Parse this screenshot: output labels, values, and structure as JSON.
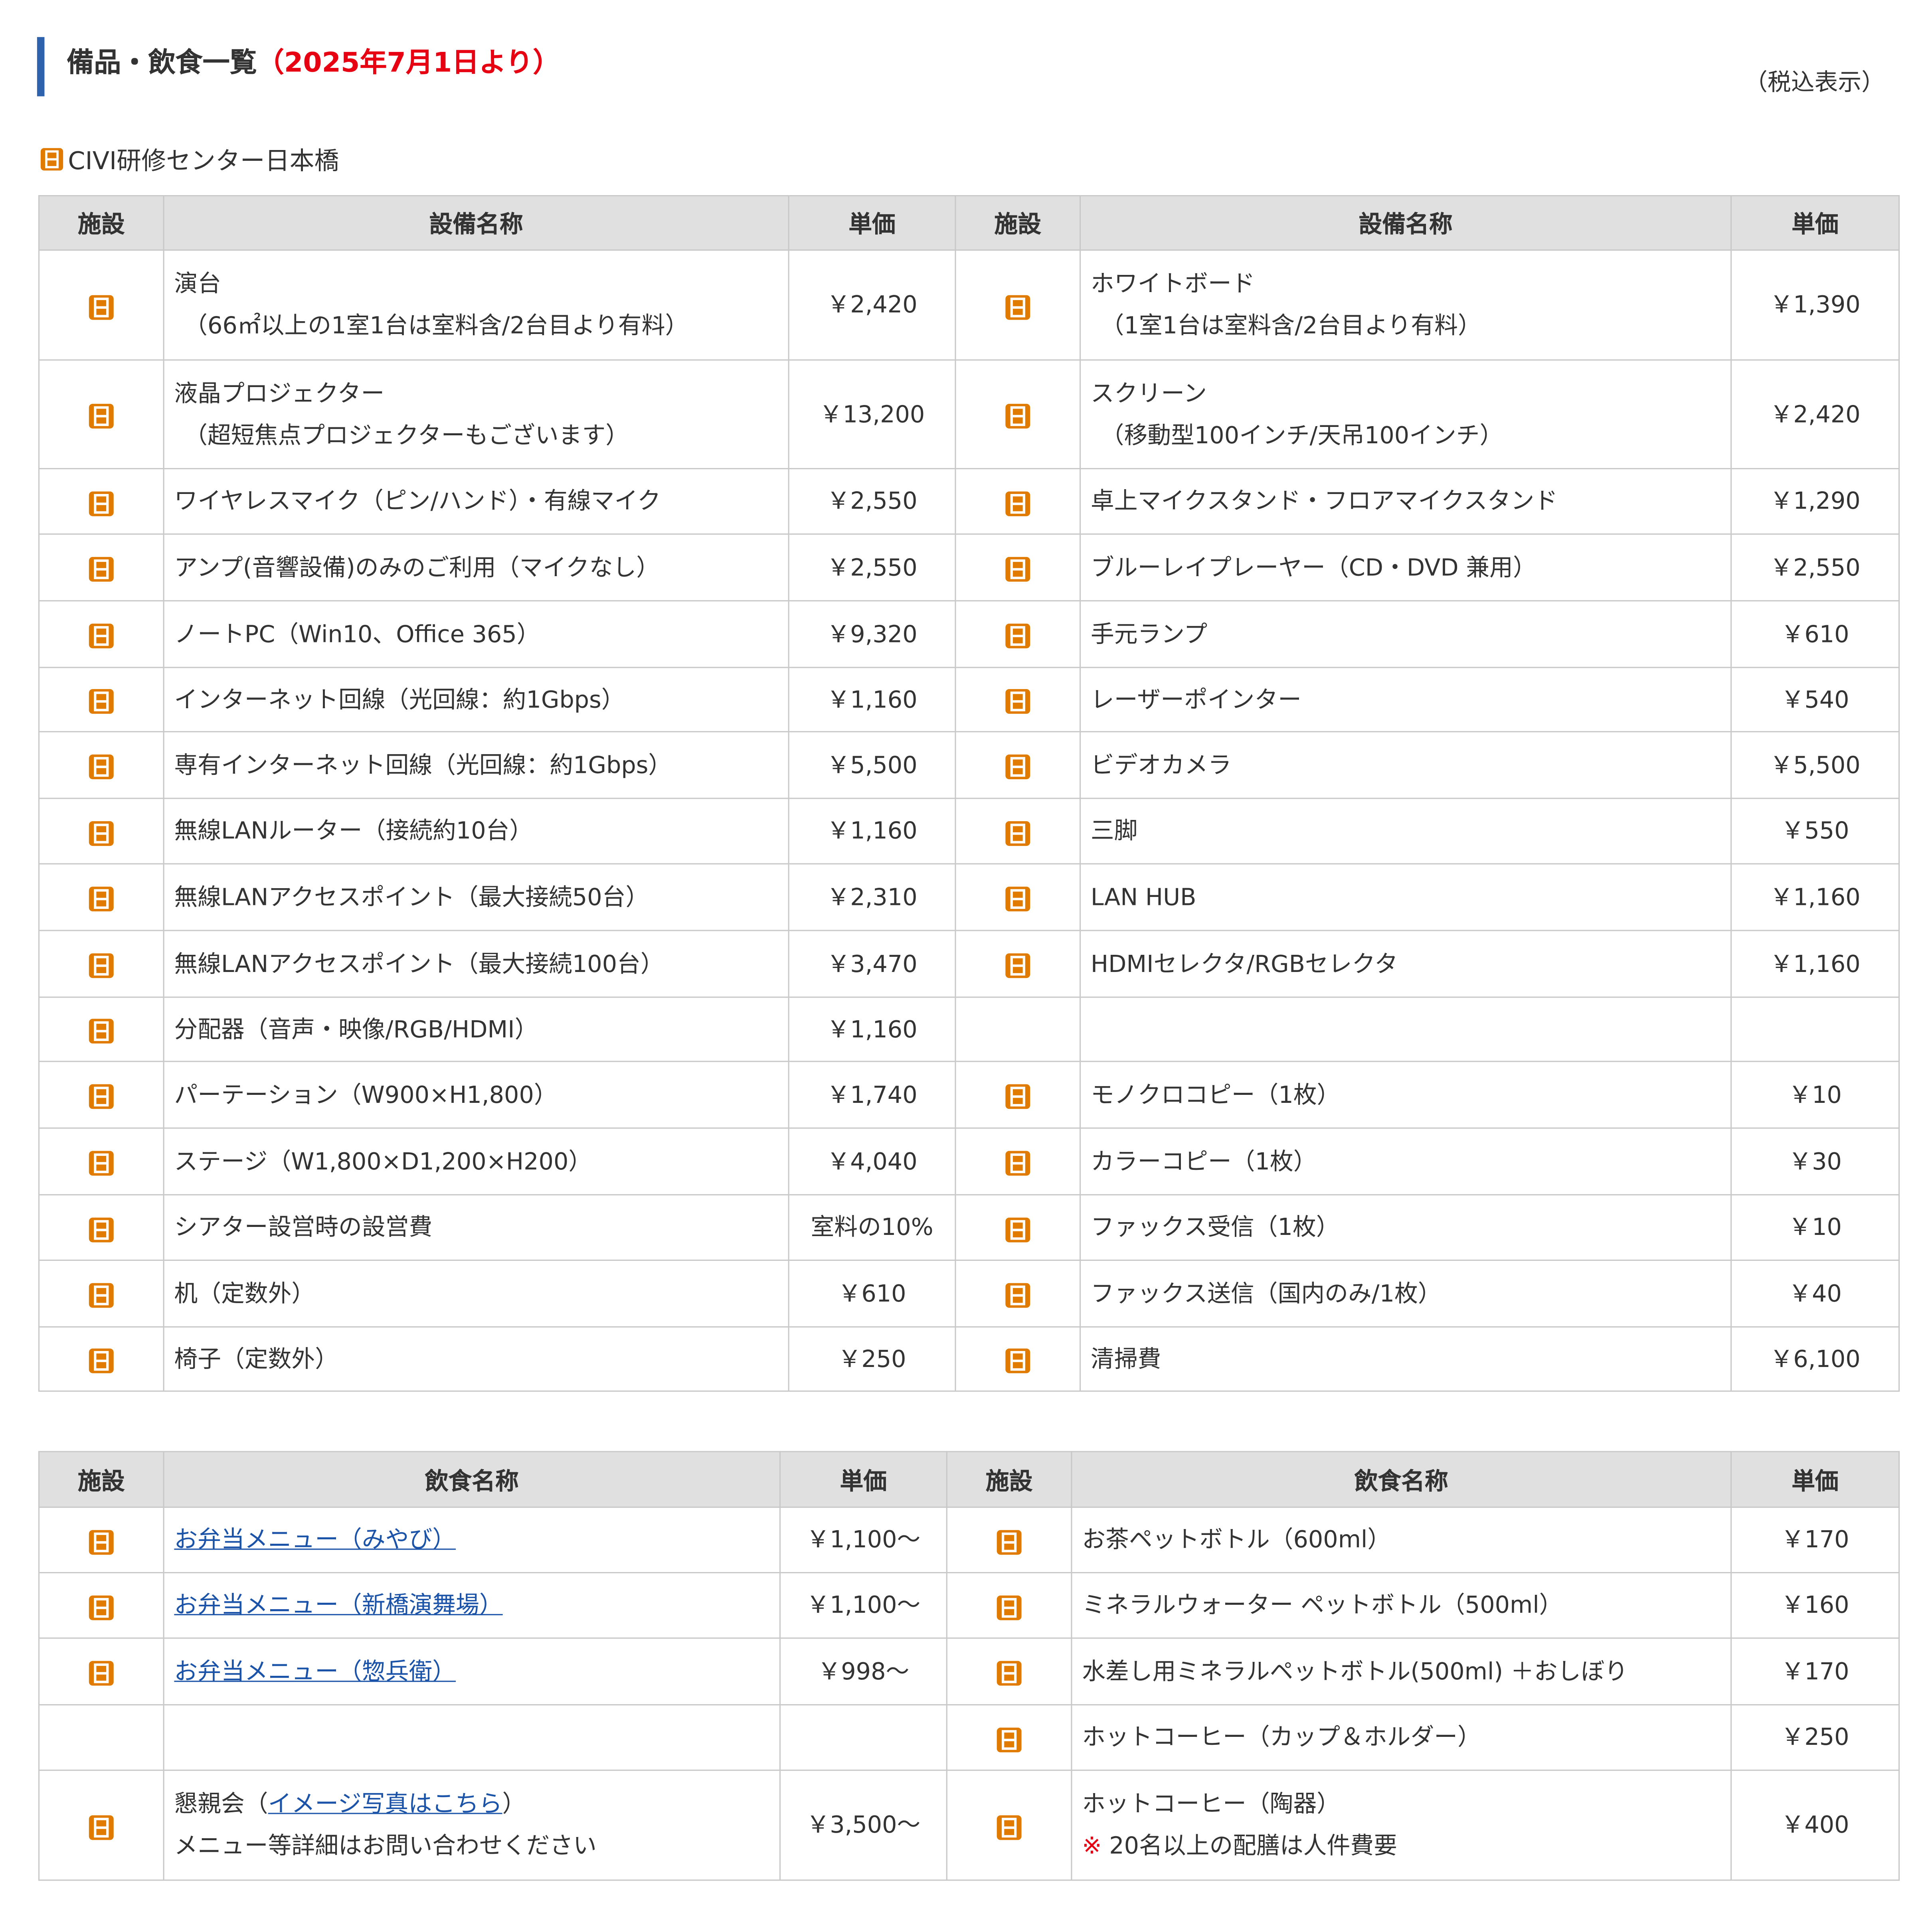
{
  "page": {
    "heading": "備品・飲食一覧",
    "heading_date": "（2025年7月1日より）",
    "tax_note": "（税込表示）",
    "venue": "CIVI研修センター日本橋",
    "facility_icon": "nihonbashi-facility-icon",
    "accent_color": "#2f62ad",
    "icon_color": "#e07b00",
    "highlight_color": "#e60012",
    "link_color": "#1a53a7"
  },
  "equipment": {
    "headers": {
      "facility": "施設",
      "name": "設備名称",
      "price": "単価"
    },
    "left": [
      {
        "name": "演台",
        "note": "（66㎡以上の1室1台は室料含/2台目より有料）",
        "price": "￥2,420"
      },
      {
        "name": "液晶プロジェクター",
        "note": "（超短焦点プロジェクターもございます）",
        "price": "￥13,200"
      },
      {
        "name": "ワイヤレスマイク（ピン/ハンド）・有線マイク",
        "price": "￥2,550"
      },
      {
        "name": "アンプ(音響設備)のみのご利用（マイクなし）",
        "price": "￥2,550"
      },
      {
        "name": "ノートPC（Win10、Office 365）",
        "price": "￥9,320"
      },
      {
        "name": "インターネット回線（光回線：約1Gbps）",
        "price": "￥1,160"
      },
      {
        "name": "専有インターネット回線（光回線：約1Gbps）",
        "price": "￥5,500"
      },
      {
        "name": "無線LANルーター（接続約10台）",
        "price": "￥1,160"
      },
      {
        "name": "無線LANアクセスポイント（最大接続50台）",
        "price": "￥2,310"
      },
      {
        "name": "無線LANアクセスポイント（最大接続100台）",
        "price": "￥3,470"
      },
      {
        "name": "分配器（音声・映像/RGB/HDMI）",
        "price": "￥1,160"
      },
      {
        "name": "パーテーション（W900×H1,800）",
        "price": "￥1,740"
      },
      {
        "name": "ステージ（W1,800×D1,200×H200）",
        "price": "￥4,040"
      },
      {
        "name": "シアター設営時の設営費",
        "price": "室料の10%"
      },
      {
        "name": "机（定数外）",
        "price": "￥610"
      },
      {
        "name": "椅子（定数外）",
        "price": "￥250"
      }
    ],
    "right": [
      {
        "name": "ホワイトボード",
        "note": "（1室1台は室料含/2台目より有料）",
        "price": "￥1,390"
      },
      {
        "name": "スクリーン",
        "note": "（移動型100インチ/天吊100インチ）",
        "price": "￥2,420"
      },
      {
        "name": "卓上マイクスタンド・フロアマイクスタンド",
        "price": "￥1,290"
      },
      {
        "name": "ブルーレイプレーヤー（CD・DVD 兼用）",
        "price": "￥2,550"
      },
      {
        "name": "手元ランプ",
        "price": "￥610"
      },
      {
        "name": "レーザーポインター",
        "price": "￥540"
      },
      {
        "name": "ビデオカメラ",
        "price": "￥5,500"
      },
      {
        "name": "三脚",
        "price": "￥550"
      },
      {
        "name": "LAN HUB",
        "price": "￥1,160"
      },
      {
        "name": "HDMIセレクタ/RGBセレクタ",
        "price": "￥1,160"
      },
      {
        "empty": true
      },
      {
        "name": "モノクロコピー（1枚）",
        "price": "￥10"
      },
      {
        "name": "カラーコピー（1枚）",
        "price": "￥30"
      },
      {
        "name": "ファックス受信（1枚）",
        "price": "￥10"
      },
      {
        "name": "ファックス送信（国内のみ/1枚）",
        "price": "￥40"
      },
      {
        "name": "清掃費",
        "price": "￥6,100"
      }
    ]
  },
  "food": {
    "headers": {
      "facility": "施設",
      "name": "飲食名称",
      "price": "単価"
    },
    "left": [
      {
        "link": "お弁当メニュー（みやび）",
        "price": "￥1,100～"
      },
      {
        "link": "お弁当メニュー（新橋演舞場）",
        "price": "￥1,100～"
      },
      {
        "link": "お弁当メニュー（惣兵衛）",
        "price": "￥998～"
      },
      {
        "empty": true
      },
      {
        "prefix": "懇親会（",
        "link": "イメージ写真はこちら",
        "suffix": "）",
        "note": "メニュー等詳細はお問い合わせください",
        "price": "￥3,500～"
      }
    ],
    "right": [
      {
        "name": "お茶ペットボトル（600ml）",
        "price": "￥170"
      },
      {
        "name": "ミネラルウォーター ペットボトル（500ml）",
        "price": "￥160"
      },
      {
        "name": "水差し用ミネラルペットボトル(500ml) ＋おしぼり",
        "price": "￥170"
      },
      {
        "name": "ホットコーヒー（カップ＆ホルダー）",
        "price": "￥250"
      },
      {
        "name": "ホットコーヒー（陶器）",
        "mark": "※",
        "note": "20名以上の配膳は人件費要",
        "price": "￥400"
      }
    ]
  }
}
